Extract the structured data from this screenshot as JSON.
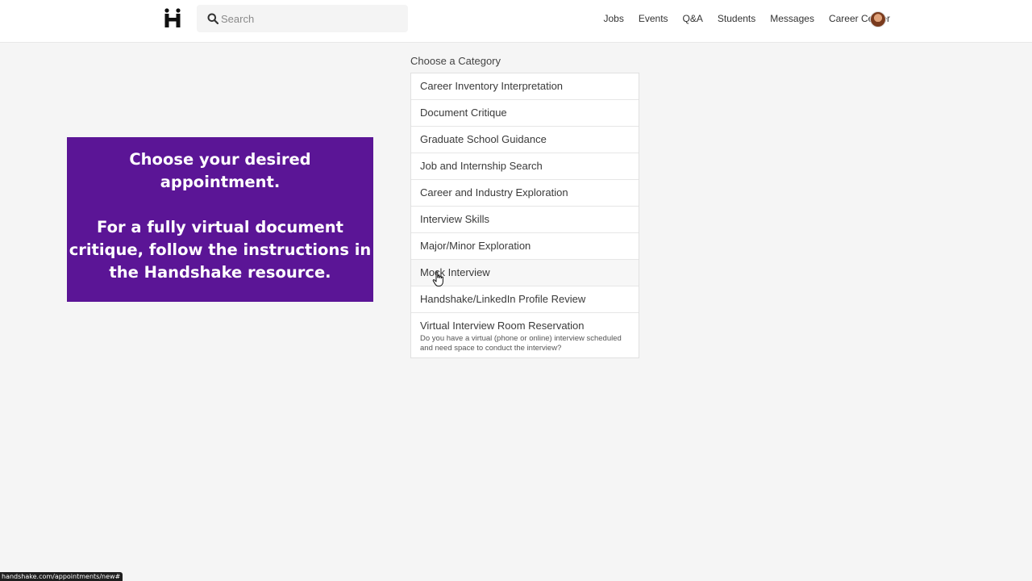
{
  "header": {
    "logo_icon": "handshake-logo-icon",
    "search": {
      "placeholder": "Search",
      "value": "",
      "icon": "search-icon"
    },
    "nav": [
      "Jobs",
      "Events",
      "Q&A",
      "Students",
      "Messages",
      "Career Center"
    ],
    "avatar_icon": "user-avatar"
  },
  "promo": {
    "line1": "Choose your desired appointment.",
    "line2": "For a fully virtual document critique, follow the instructions in the Handshake resource.",
    "background": "#5b1596"
  },
  "categories": {
    "title": "Choose a Category",
    "items": [
      {
        "label": "Career Inventory Interpretation"
      },
      {
        "label": "Document Critique"
      },
      {
        "label": "Graduate School Guidance"
      },
      {
        "label": "Job and Internship Search"
      },
      {
        "label": "Career and Industry Exploration"
      },
      {
        "label": "Interview Skills"
      },
      {
        "label": "Major/Minor Exploration"
      },
      {
        "label": "Mock Interview"
      },
      {
        "label": "Handshake/LinkedIn Profile Review"
      },
      {
        "label": "Virtual Interview Room Reservation",
        "description": "Do you have a virtual (phone or online) interview scheduled and need space to conduct the interview?"
      }
    ]
  },
  "status_bar": {
    "url": "handshake.com/appointments/new#"
  },
  "colors": {
    "accent": "#5b1596",
    "background": "#f5f5f5",
    "card": "#ffffff"
  }
}
